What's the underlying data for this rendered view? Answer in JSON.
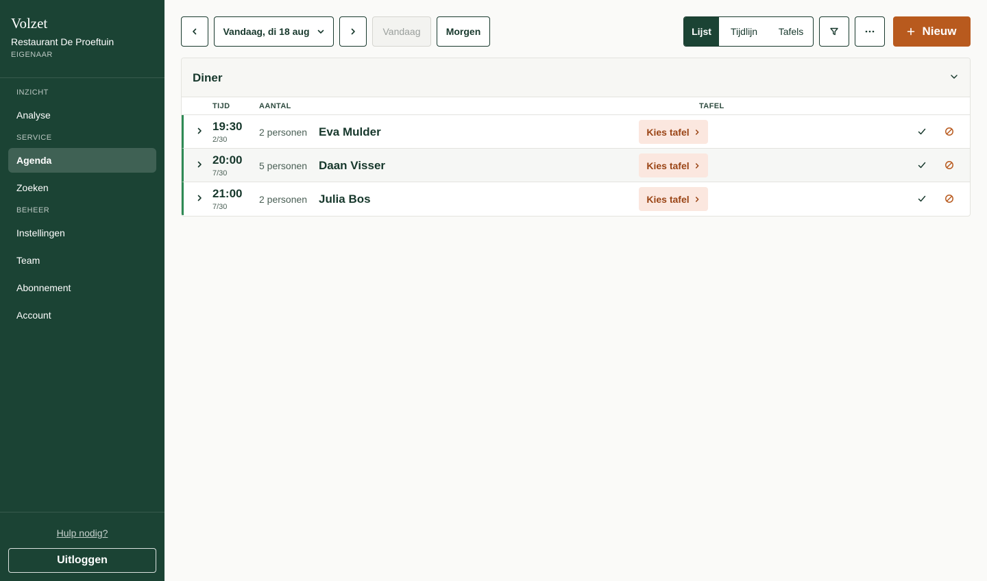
{
  "sidebar": {
    "brand": "Volzet",
    "restaurant": "Restaurant De Proeftuin",
    "role": "EIGENAAR",
    "sections": [
      {
        "title": "INZICHT",
        "items": [
          {
            "label": "Analyse",
            "active": false
          }
        ]
      },
      {
        "title": "SERVICE",
        "items": [
          {
            "label": "Agenda",
            "active": true
          },
          {
            "label": "Zoeken",
            "active": false
          }
        ]
      },
      {
        "title": "BEHEER",
        "items": [
          {
            "label": "Instellingen",
            "active": false
          },
          {
            "label": "Team",
            "active": false
          },
          {
            "label": "Abonnement",
            "active": false
          },
          {
            "label": "Account",
            "active": false
          }
        ]
      }
    ],
    "help_link": "Hulp nodig?",
    "logout_label": "Uitloggen"
  },
  "toolbar": {
    "prev_icon": "chevron-left-icon",
    "date_label": "Vandaag, di 18 aug",
    "date_icon": "chevron-down-icon",
    "next_icon": "chevron-right-icon",
    "today_label": "Vandaag",
    "today_disabled": true,
    "tomorrow_label": "Morgen",
    "views": [
      {
        "label": "Lijst",
        "active": true
      },
      {
        "label": "Tijdlijn",
        "active": false
      },
      {
        "label": "Tafels",
        "active": false
      }
    ],
    "filter_icon": "filter-icon",
    "more_icon": "more-dots-icon",
    "new_label": "Nieuw",
    "new_icon": "plus-icon"
  },
  "panel": {
    "title": "Diner",
    "columns": {
      "time": "TIJD",
      "count": "AANTAL",
      "table": "TAFEL"
    },
    "rows": [
      {
        "time": "19:30",
        "slot": "2/30",
        "count": "2 personen",
        "name": "Eva Mulder",
        "table_action": "Kies tafel"
      },
      {
        "time": "20:00",
        "slot": "7/30",
        "count": "5 personen",
        "name": "Daan Visser",
        "table_action": "Kies tafel"
      },
      {
        "time": "21:00",
        "slot": "7/30",
        "count": "2 personen",
        "name": "Julia Bos",
        "table_action": "Kies tafel"
      }
    ]
  },
  "colors": {
    "sidebar_bg": "#1b4334",
    "accent": "#b85a1e",
    "row_marker": "#2f8a55",
    "table_chip_bg": "#fbe7df",
    "table_chip_text": "#9a4516"
  }
}
